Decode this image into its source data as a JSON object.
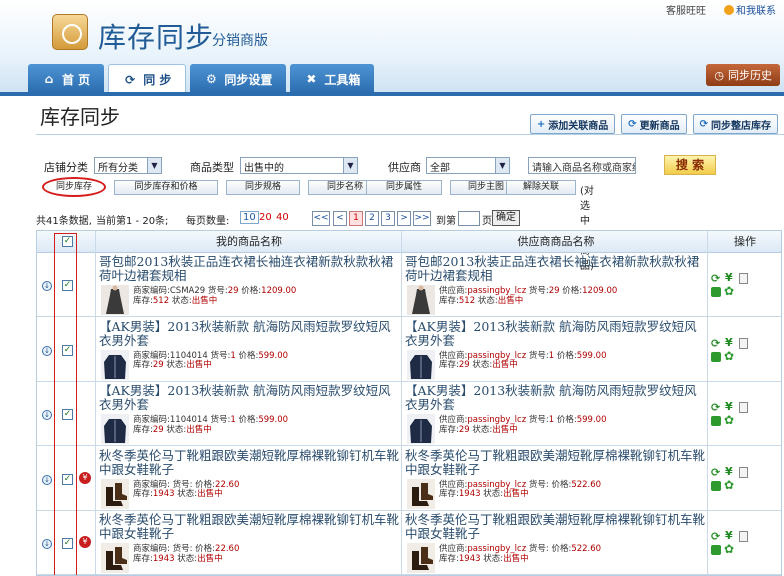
{
  "header": {
    "service_link": "客服旺旺",
    "contact_link": "和我联系",
    "app_title": "库存同步",
    "app_subtitle": "分销商版",
    "nav_tabs": [
      {
        "label": "首 页",
        "icon": "home-icon"
      },
      {
        "label": "同 步",
        "icon": "sync-icon"
      },
      {
        "label": "同步设置",
        "icon": "gear-icon"
      },
      {
        "label": "工具箱",
        "icon": "tools-icon"
      }
    ],
    "history_button": "同步历史"
  },
  "page": {
    "title": "库存同步",
    "actions": {
      "add_linked": "添加关联商品",
      "update_goods": "更新商品",
      "sync_whole_store": "同步整店库存"
    }
  },
  "filters": {
    "store_category_label": "店铺分类",
    "store_category_value": "所有分类",
    "product_type_label": "商品类型",
    "product_type_value": "出售中的",
    "supplier_label": "供应商",
    "supplier_value": "全部",
    "search_placeholder": "请输入商品名称或商家编",
    "search_button": "搜 索"
  },
  "sync_buttons": {
    "sync_stock": "同步库存",
    "sync_stock_price": "同步库存和价格",
    "sync_spec": "同步规格",
    "sync_name": "同步名称",
    "sync_attr": "同步属性",
    "sync_main_img": "同步主图",
    "unlink": "解除关联",
    "note": "(对选中的商品)"
  },
  "pager": {
    "total_text": "共41条数据,",
    "current_text": "当前第1 - 20条;",
    "page_size_label": "每页数量:",
    "page_sizes": [
      "10",
      "20",
      "40"
    ],
    "first": "<<",
    "prev": "<",
    "pages": [
      "1",
      "2",
      "3"
    ],
    "next": ">",
    "last": ">>",
    "goto_label": "到第",
    "goto_unit": "页",
    "confirm": "确定"
  },
  "table": {
    "col_my_name": "我的商品名称",
    "col_supplier_name": "供应商商品名称",
    "col_ops": "操作",
    "lbl_merchant_code": "商家编码:",
    "lbl_item_no": "货号:",
    "lbl_price": "价格:",
    "lbl_stock": "库存:",
    "lbl_status": "状态:",
    "lbl_supplier": "供应商:",
    "rows": [
      {
        "my_name": "哥包邮2013秋装正品连衣裙长袖连衣裙新款秋款秋裙荷叶边裙套规相",
        "my_code": "CSMA29",
        "my_item_no": "29",
        "my_price": "1209.00",
        "my_stock": "512",
        "status": "出售中",
        "sup_name": "哥包邮2013秋装正品连衣裙长袖连衣裙新款秋款秋裙荷叶边裙套规相",
        "sup_supplier": "passingby_lcz",
        "sup_item_no": "29",
        "sup_price": "1209.00",
        "sup_stock": "512",
        "thumb": "dress",
        "flag": false
      },
      {
        "my_name": "【AK男装】2013秋装新款 航海防风雨短款罗纹短风衣男外套",
        "my_code": "1104014",
        "my_item_no": "1",
        "my_price": "599.00",
        "my_stock": "29",
        "status": "出售中",
        "sup_name": "【AK男装】2013秋装新款 航海防风雨短款罗纹短风衣男外套",
        "sup_supplier": "passingby_lcz",
        "sup_item_no": "1",
        "sup_price": "599.00",
        "sup_stock": "29",
        "thumb": "jacket",
        "flag": false
      },
      {
        "my_name": "【AK男装】2013秋装新款 航海防风雨短款罗纹短风衣男外套",
        "my_code": "1104014",
        "my_item_no": "1",
        "my_price": "599.00",
        "my_stock": "29",
        "status": "出售中",
        "sup_name": "【AK男装】2013秋装新款 航海防风雨短款罗纹短风衣男外套",
        "sup_supplier": "passingby_lcz",
        "sup_item_no": "1",
        "sup_price": "599.00",
        "sup_stock": "29",
        "thumb": "jacket",
        "flag": false
      },
      {
        "my_name": "秋冬季英伦马丁靴粗跟欧美潮短靴厚棉裸靴铆钉机车靴中跟女鞋靴子",
        "my_code": "",
        "my_item_no": "",
        "my_price": "22.60",
        "my_stock": "1943",
        "status": "出售中",
        "sup_name": "秋冬季英伦马丁靴粗跟欧美潮短靴厚棉裸靴铆钉机车靴中跟女鞋靴子",
        "sup_supplier": "passingby_lcz",
        "sup_item_no": "",
        "sup_price": "522.60",
        "sup_stock": "1943",
        "thumb": "boots",
        "flag": true
      },
      {
        "my_name": "秋冬季英伦马丁靴粗跟欧美潮短靴厚棉裸靴铆钉机车靴中跟女鞋靴子",
        "my_code": "",
        "my_item_no": "",
        "my_price": "22.60",
        "my_stock": "1943",
        "status": "出售中",
        "sup_name": "秋冬季英伦马丁靴粗跟欧美潮短靴厚棉裸靴铆钉机车靴中跟女鞋靴子",
        "sup_supplier": "passingby_lcz",
        "sup_item_no": "",
        "sup_price": "522.60",
        "sup_stock": "1943",
        "thumb": "boots",
        "flag": true
      }
    ]
  },
  "colors": {
    "brand_blue": "#225c97",
    "nav_blue": "#2a6cae",
    "alert_red": "#d31c1c",
    "history_brown": "#8e3c16"
  }
}
